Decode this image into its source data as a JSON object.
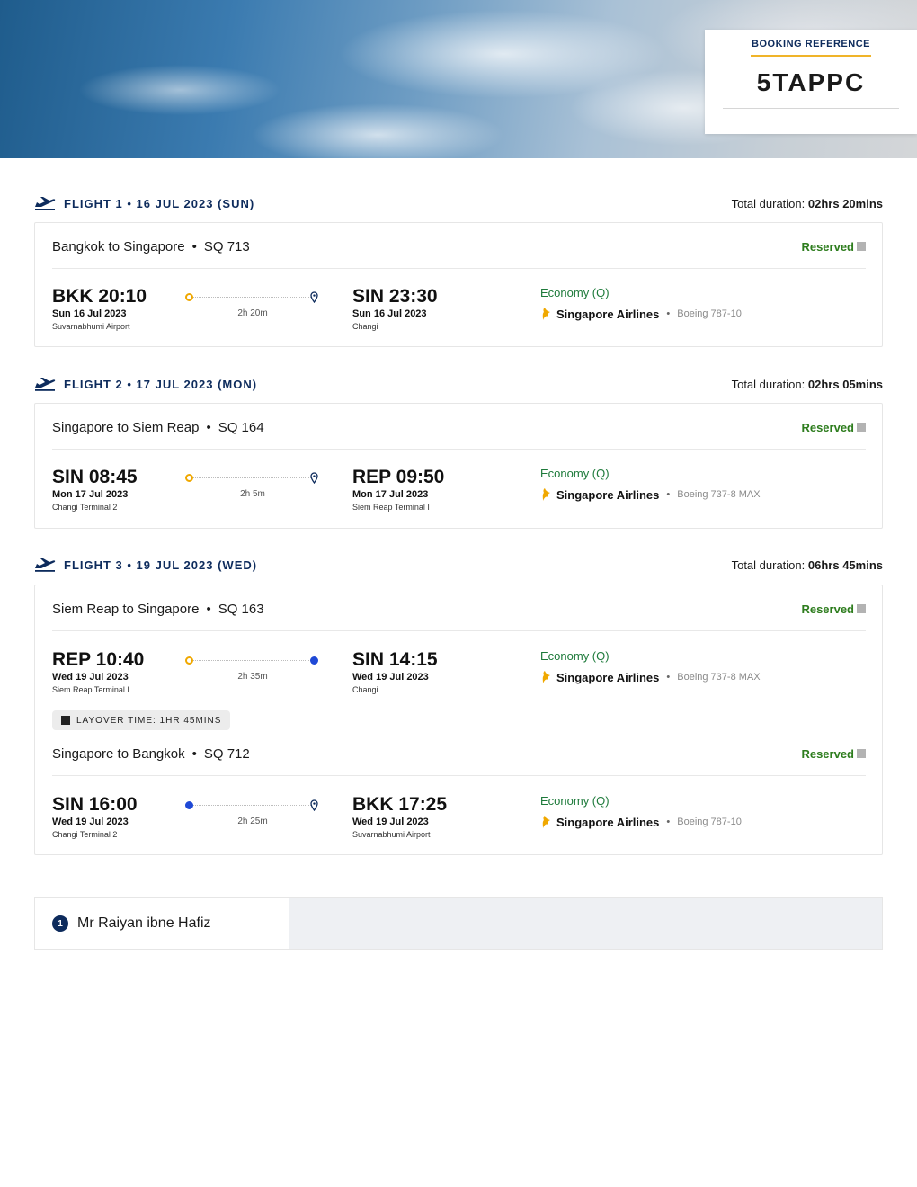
{
  "booking": {
    "label": "BOOKING REFERENCE",
    "code": "5TAPPC"
  },
  "flights": [
    {
      "title": "FLIGHT 1 • 16 JUL 2023 (SUN)",
      "total_label": "Total duration:",
      "total_value": "02hrs 20mins",
      "segments": [
        {
          "route": "Bangkok to Singapore",
          "dot": "•",
          "flight_no": "SQ 713",
          "status": "Reserved",
          "dep_time": "BKK 20:10",
          "dep_date": "Sun 16 Jul 2023",
          "dep_airport": "Suvarnabhumi Airport",
          "duration": "2h 20m",
          "arr_time": "SIN 23:30",
          "arr_date": "Sun 16 Jul 2023",
          "arr_airport": "Changi",
          "cabin": "Economy (Q)",
          "airline": "Singapore Airlines",
          "aircraft": "Boeing 787-10"
        }
      ]
    },
    {
      "title": "FLIGHT 2 • 17 JUL 2023 (MON)",
      "total_label": "Total duration:",
      "total_value": "02hrs 05mins",
      "segments": [
        {
          "route": "Singapore to Siem Reap",
          "dot": "•",
          "flight_no": "SQ 164",
          "status": "Reserved",
          "dep_time": "SIN 08:45",
          "dep_date": "Mon 17 Jul 2023",
          "dep_airport": "Changi Terminal 2",
          "duration": "2h 5m",
          "arr_time": "REP 09:50",
          "arr_date": "Mon 17 Jul 2023",
          "arr_airport": "Siem Reap Terminal I",
          "cabin": "Economy (Q)",
          "airline": "Singapore Airlines",
          "aircraft": "Boeing 737-8 MAX"
        }
      ]
    },
    {
      "title": "FLIGHT 3 • 19 JUL 2023 (WED)",
      "total_label": "Total duration:",
      "total_value": "06hrs 45mins",
      "layover": "LAYOVER TIME: 1HR 45MINS",
      "segments": [
        {
          "route": "Siem Reap to Singapore",
          "dot": "•",
          "flight_no": "SQ 163",
          "status": "Reserved",
          "dep_time": "REP 10:40",
          "dep_date": "Wed 19 Jul 2023",
          "dep_airport": "Siem Reap Terminal I",
          "duration": "2h 35m",
          "arr_time": "SIN 14:15",
          "arr_date": "Wed 19 Jul 2023",
          "arr_airport": "Changi",
          "cabin": "Economy (Q)",
          "airline": "Singapore Airlines",
          "aircraft": "Boeing 737-8 MAX"
        },
        {
          "route": "Singapore to Bangkok",
          "dot": "•",
          "flight_no": "SQ 712",
          "status": "Reserved",
          "dep_time": "SIN 16:00",
          "dep_date": "Wed 19 Jul 2023",
          "dep_airport": "Changi Terminal 2",
          "duration": "2h 25m",
          "arr_time": "BKK 17:25",
          "arr_date": "Wed 19 Jul 2023",
          "arr_airport": "Suvarnabhumi Airport",
          "cabin": "Economy (Q)",
          "airline": "Singapore Airlines",
          "aircraft": "Boeing 787-10"
        }
      ]
    }
  ],
  "passenger": {
    "number": "1",
    "name": "Mr Raiyan ibne Hafiz"
  },
  "icons": {
    "flight_header": "plane-takeoff-icon",
    "origin": "origin-circle-icon",
    "destination": "location-pin-icon",
    "connection": "connection-dot-icon",
    "airline": "singapore-airlines-bird-icon",
    "status": "status-square-icon",
    "layover": "layover-square-icon"
  },
  "colors": {
    "navy": "#0d2b5c",
    "accent_gold": "#f0b429",
    "reserved_green": "#2e7d1e",
    "cabin_green": "#1d7a3a",
    "connection_blue": "#1f49d6",
    "origin_orange": "#f0a800"
  }
}
